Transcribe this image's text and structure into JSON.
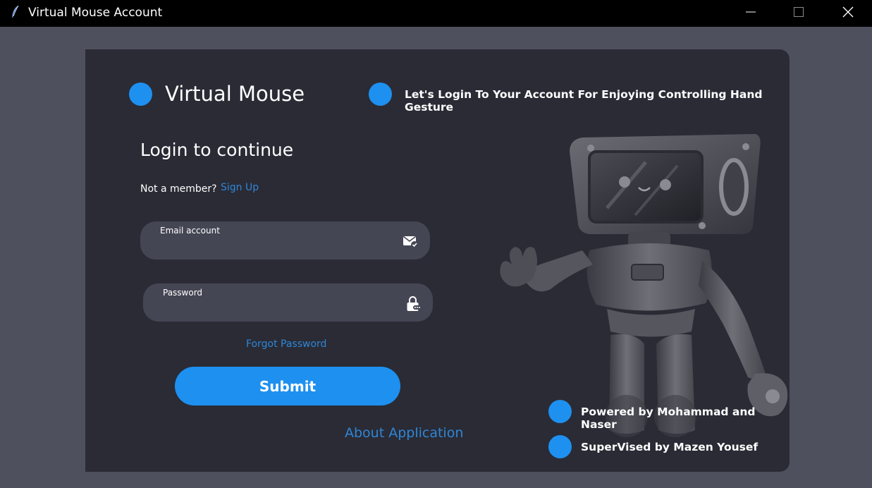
{
  "window": {
    "title": "Virtual Mouse Account",
    "icon": "feather-icon",
    "controls": [
      "minimize-icon",
      "maximize-icon",
      "close-icon"
    ]
  },
  "brand": {
    "name": "Virtual Mouse",
    "tagline": "Let's Login To Your Account For Enjoying Controlling Hand Gesture"
  },
  "login": {
    "heading": "Login to continue",
    "not_member_text": "Not a member?",
    "signup_label": "Sign Up",
    "email": {
      "label": "Email account",
      "value": "",
      "icon": "mail-check-icon"
    },
    "password": {
      "label": "Password",
      "value": "",
      "icon": "lock-icon"
    },
    "forgot_label": "Forgot Password",
    "submit_label": "Submit",
    "about_label": "About Application"
  },
  "credits": {
    "powered_by": "Powered by Mohammad and Naser",
    "supervised_by": "SuperVised by Mazen Yousef"
  },
  "colors": {
    "accent": "#1e90f0",
    "link": "#2f86d6",
    "card_bg": "#2a2b35",
    "field_bg": "#454654",
    "window_bg": "#4f505e"
  }
}
